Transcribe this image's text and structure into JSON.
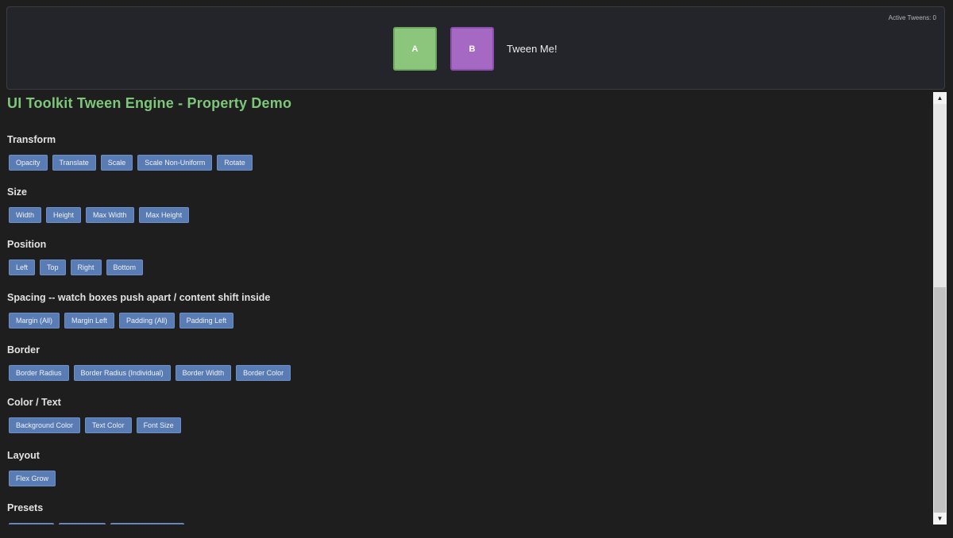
{
  "preview": {
    "active_tweens": "Active Tweens: 0",
    "box_a": "A",
    "box_b": "B",
    "tween_label": "Tween Me!"
  },
  "title": "UI Toolkit Tween Engine - Property Demo",
  "sections": [
    {
      "title": "Transform",
      "buttons": [
        "Opacity",
        "Translate",
        "Scale",
        "Scale Non-Uniform",
        "Rotate"
      ]
    },
    {
      "title": "Size",
      "buttons": [
        "Width",
        "Height",
        "Max Width",
        "Max Height"
      ]
    },
    {
      "title": "Position",
      "buttons": [
        "Left",
        "Top",
        "Right",
        "Bottom"
      ]
    },
    {
      "title": "Spacing -- watch boxes push apart / content shift inside",
      "buttons": [
        "Margin (All)",
        "Margin Left",
        "Padding (All)",
        "Padding Left"
      ]
    },
    {
      "title": "Border",
      "buttons": [
        "Border Radius",
        "Border Radius (Individual)",
        "Border Width",
        "Border Color"
      ]
    },
    {
      "title": "Color / Text",
      "buttons": [
        "Background Color",
        "Text Color",
        "Font Size"
      ]
    },
    {
      "title": "Layout",
      "buttons": [
        "Flex Grow"
      ]
    },
    {
      "title": "Presets",
      "buttons": [
        "",
        "",
        ""
      ]
    }
  ],
  "scrollbar": {
    "up_icon": "▲",
    "down_icon": "▼"
  },
  "colors": {
    "title": "#7ec77a",
    "button_bg": "#5a7cb5",
    "box_a": "#8cc57c",
    "box_b": "#a569c4",
    "background": "#1e1e1f"
  }
}
